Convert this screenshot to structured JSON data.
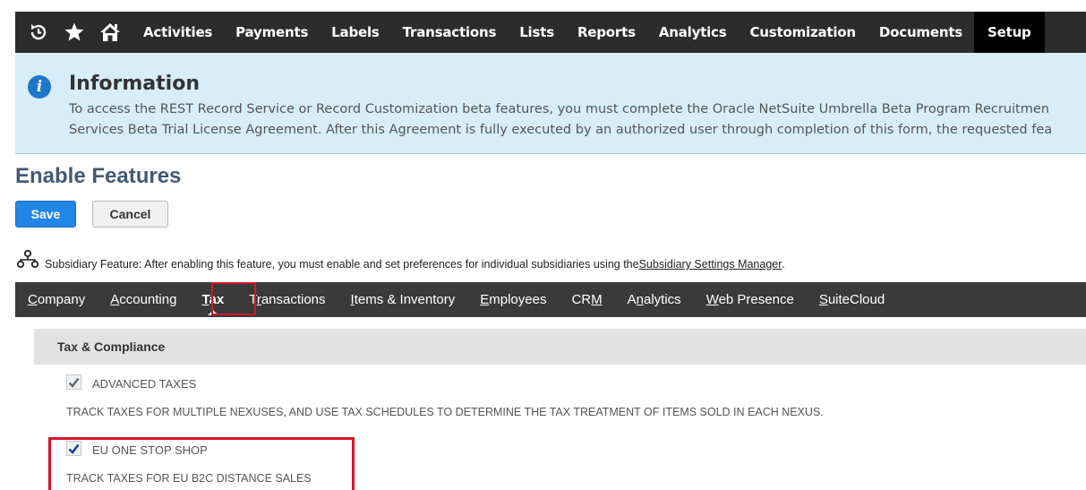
{
  "top_nav": {
    "icons": [
      "recent-records-icon",
      "star-icon",
      "home-icon"
    ],
    "items": [
      {
        "label": "Activities"
      },
      {
        "label": "Payments"
      },
      {
        "label": "Labels"
      },
      {
        "label": "Transactions"
      },
      {
        "label": "Lists"
      },
      {
        "label": "Reports"
      },
      {
        "label": "Analytics"
      },
      {
        "label": "Customization"
      },
      {
        "label": "Documents"
      },
      {
        "label": "Setup",
        "active": true
      }
    ]
  },
  "info": {
    "title": "Information",
    "line1": "To access the REST Record Service or Record Customization beta features, you must complete the Oracle NetSuite Umbrella Beta Program Recruitmen",
    "line2": "Services Beta Trial License Agreement. After this Agreement is fully executed by an authorized user through completion of this form, the requested fea",
    "icon": "info-icon",
    "color": "#1e76c9"
  },
  "page": {
    "title": "Enable Features",
    "save_label": "Save",
    "cancel_label": "Cancel",
    "save_color": "#2187e7"
  },
  "subsidiary_note": {
    "text": "Subsidiary Feature: After enabling this feature, you must enable and set preferences for individual subsidiaries using the ",
    "link": "Subsidiary Settings Manager",
    "suffix": "."
  },
  "sub_tabs": [
    {
      "ul": "C",
      "rest": "ompany"
    },
    {
      "ul": "A",
      "rest": "ccounting"
    },
    {
      "ul": "T",
      "rest": "ax",
      "active": true
    },
    {
      "pre": "T",
      "ul": "r",
      "rest": "ansactions"
    },
    {
      "ul": "I",
      "rest": "tems & Inventory"
    },
    {
      "ul": "E",
      "rest": "mployees"
    },
    {
      "pre": "CR",
      "ul": "M",
      "rest": ""
    },
    {
      "pre": "A",
      "ul": "n",
      "rest": "alytics"
    },
    {
      "ul": "W",
      "rest": "eb Presence"
    },
    {
      "ul": "S",
      "rest": "uiteCloud"
    }
  ],
  "section": {
    "title": "Tax & Compliance",
    "features": [
      {
        "label": "ADVANCED TAXES",
        "description": "TRACK TAXES FOR MULTIPLE NEXUSES, AND USE TAX SCHEDULES TO DETERMINE THE TAX TREATMENT OF ITEMS SOLD IN EACH NEXUS.",
        "checked": true,
        "check_color": "#666666"
      },
      {
        "label": "EU ONE STOP SHOP",
        "description": "TRACK TAXES FOR EU B2C DISTANCE SALES",
        "checked": true,
        "check_color": "#1b3a8c"
      }
    ]
  },
  "highlight_color": "#d0172a"
}
